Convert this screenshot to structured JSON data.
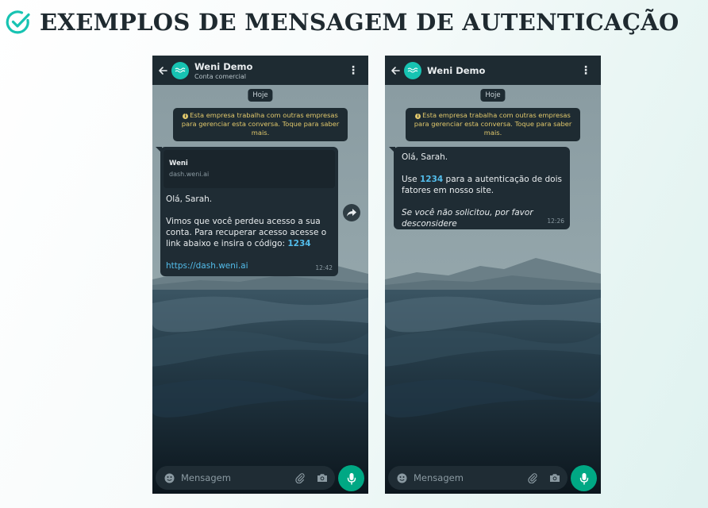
{
  "page": {
    "title": "EXEMPLOS DE MENSAGEM DE AUTENTICAÇÃO",
    "accent_color": "#17c3b2"
  },
  "phones": [
    {
      "chat_name": "Weni Demo",
      "chat_subtitle": "Conta comercial",
      "date_label": "Hoje",
      "notice": "Esta empresa trabalha com outras empresas para gerenciar esta conversa. Toque para saber mais.",
      "link_preview": {
        "title": "Weni",
        "url": "dash.weni.ai"
      },
      "message": {
        "greeting": "Olá, Sarah.",
        "body": "Vimos que você perdeu acesso a sua conta. Para recuperar acesso acesse o link abaixo e insira o código:",
        "code": "1234",
        "link": "https://dash.weni.ai",
        "time": "12:42"
      },
      "composer_placeholder": "Mensagem"
    },
    {
      "chat_name": "Weni Demo",
      "date_label": "Hoje",
      "notice": "Esta empresa trabalha com outras empresas para gerenciar esta conversa. Toque para saber mais.",
      "message": {
        "greeting": "Olá, Sarah.",
        "body_prefix": "Use",
        "code": "1234",
        "body_suffix": "para a autenticação de dois fatores em nosso site.",
        "footer": "Se você não solicitou, por favor desconsidere",
        "time": "12:26"
      },
      "composer_placeholder": "Mensagem"
    }
  ],
  "icons": [
    "check-circle-icon",
    "back-arrow-icon",
    "weni-logo-icon",
    "more-vert-icon",
    "info-icon",
    "share-icon",
    "emoji-icon",
    "attach-icon",
    "camera-icon",
    "mic-icon"
  ],
  "colors": {
    "header_bg": "#1e2b32",
    "bubble_bg": "#1f2c34",
    "notice_text": "#e0c76b",
    "link": "#53bdeb",
    "mic_button": "#00a884"
  }
}
